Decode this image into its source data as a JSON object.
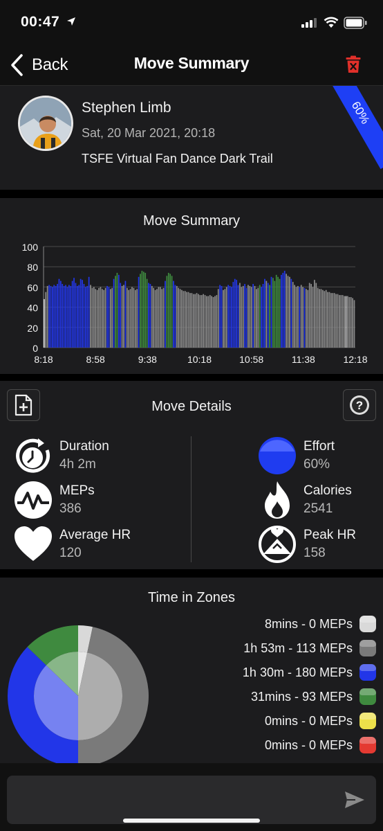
{
  "status_bar": {
    "time": "00:47"
  },
  "nav": {
    "back_label": "Back",
    "title": "Move Summary"
  },
  "profile": {
    "name": "Stephen Limb",
    "date": "Sat, 20 Mar 2021, 20:18",
    "move_name": "TSFE Virtual Fan Dance Dark Trail",
    "effort_badge": "60%"
  },
  "chart_data": {
    "type": "bar",
    "title": "Move Summary",
    "xlabel": "",
    "ylabel": "",
    "ylim": [
      0,
      100
    ],
    "yticks": [
      "100",
      "80",
      "60",
      "40",
      "20",
      "0"
    ],
    "xticks": [
      "8:18",
      "8:58",
      "9:38",
      "10:18",
      "10:58",
      "11:38",
      "12:18"
    ],
    "zone_colors": {
      "white": "#d9d9d9",
      "grey": "#8c8c8c",
      "blue": "#2236e8",
      "green": "#3f8a3f"
    },
    "values": [
      48,
      55,
      61,
      62,
      61,
      60,
      62,
      61,
      63,
      68,
      66,
      63,
      61,
      62,
      60,
      62,
      61,
      66,
      69,
      64,
      61,
      62,
      68,
      67,
      63,
      60,
      61,
      70,
      62,
      59,
      60,
      58,
      57,
      59,
      60,
      58,
      57,
      59,
      61,
      60,
      58,
      59,
      68,
      71,
      74,
      72,
      64,
      61,
      62,
      66,
      59,
      57,
      58,
      60,
      59,
      57,
      58,
      70,
      73,
      76,
      75,
      74,
      68,
      64,
      63,
      61,
      59,
      57,
      58,
      60,
      60,
      58,
      59,
      66,
      71,
      74,
      73,
      71,
      66,
      62,
      61,
      59,
      58,
      57,
      56,
      56,
      55,
      55,
      54,
      54,
      53,
      53,
      54,
      53,
      52,
      52,
      53,
      52,
      51,
      51,
      52,
      51,
      50,
      51,
      52,
      58,
      62,
      61,
      57,
      58,
      60,
      62,
      61,
      60,
      65,
      68,
      67,
      62,
      64,
      60,
      61,
      63,
      59,
      62,
      61,
      60,
      63,
      61,
      58,
      59,
      62,
      60,
      63,
      68,
      66,
      64,
      62,
      70,
      69,
      66,
      72,
      70,
      68,
      72,
      74,
      76,
      73,
      71,
      70,
      68,
      65,
      62,
      60,
      61,
      60,
      62,
      60,
      59,
      58,
      57,
      64,
      63,
      60,
      67,
      64,
      59,
      58,
      58,
      57,
      56,
      57,
      55,
      55,
      54,
      54,
      54,
      53,
      53,
      52,
      52,
      52,
      51,
      51,
      51,
      50,
      50,
      49,
      47
    ],
    "zones": [
      "white",
      "grey",
      "grey",
      "blue",
      "blue",
      "blue",
      "blue",
      "blue",
      "blue",
      "blue",
      "blue",
      "blue",
      "blue",
      "blue",
      "blue",
      "blue",
      "blue",
      "blue",
      "blue",
      "blue",
      "blue",
      "blue",
      "blue",
      "blue",
      "blue",
      "blue",
      "blue",
      "blue",
      "grey",
      "grey",
      "grey",
      "grey",
      "grey",
      "grey",
      "grey",
      "grey",
      "grey",
      "grey",
      "blue",
      "blue",
      "grey",
      "grey",
      "blue",
      "green",
      "green",
      "blue",
      "blue",
      "grey",
      "grey",
      "blue",
      "grey",
      "grey",
      "grey",
      "grey",
      "grey",
      "grey",
      "grey",
      "blue",
      "green",
      "green",
      "green",
      "green",
      "green",
      "blue",
      "blue",
      "grey",
      "grey",
      "grey",
      "grey",
      "grey",
      "grey",
      "grey",
      "grey",
      "blue",
      "green",
      "green",
      "green",
      "green",
      "blue",
      "blue",
      "grey",
      "grey",
      "grey",
      "grey",
      "grey",
      "grey",
      "grey",
      "grey",
      "grey",
      "grey",
      "grey",
      "grey",
      "grey",
      "grey",
      "grey",
      "grey",
      "grey",
      "grey",
      "grey",
      "grey",
      "grey",
      "grey",
      "grey",
      "grey",
      "grey",
      "grey",
      "blue",
      "blue",
      "grey",
      "grey",
      "grey",
      "blue",
      "blue",
      "blue",
      "blue",
      "blue",
      "blue",
      "blue",
      "grey",
      "grey",
      "grey",
      "blue",
      "blue",
      "grey",
      "grey",
      "grey",
      "blue",
      "grey",
      "grey",
      "grey",
      "green",
      "blue",
      "blue",
      "blue",
      "grey",
      "blue",
      "green",
      "blue",
      "green",
      "green",
      "green",
      "green",
      "green",
      "blue",
      "blue",
      "blue",
      "grey",
      "grey",
      "grey",
      "blue",
      "grey",
      "grey",
      "grey",
      "grey",
      "blue",
      "grey",
      "grey",
      "blue",
      "grey",
      "grey",
      "grey",
      "grey",
      "grey",
      "grey",
      "grey",
      "grey",
      "grey",
      "grey",
      "grey",
      "grey",
      "grey",
      "grey",
      "grey",
      "grey",
      "grey",
      "grey",
      "grey",
      "grey",
      "grey",
      "grey",
      "grey",
      "grey",
      "white"
    ]
  },
  "details": {
    "title": "Move Details",
    "duration": {
      "label": "Duration",
      "value": "4h 2m"
    },
    "meps": {
      "label": "MEPs",
      "value": "386"
    },
    "avg_hr": {
      "label": "Average HR",
      "value": "120"
    },
    "effort": {
      "label": "Effort",
      "value": "60%"
    },
    "calories": {
      "label": "Calories",
      "value": "2541"
    },
    "peak_hr": {
      "label": "Peak HR",
      "value": "158"
    },
    "icons": [
      "stopwatch-icon",
      "pulse-icon",
      "heart-icon",
      "effort-orb-icon",
      "flame-icon",
      "peak-hr-icon",
      "add-document-icon",
      "help-icon"
    ]
  },
  "zones": {
    "title": "Time in Zones",
    "items": [
      {
        "label": "8mins - 0 MEPs",
        "color": "#d9d9d9",
        "minutes": 8
      },
      {
        "label": "1h 53m - 113 MEPs",
        "color": "#7a7a7a",
        "minutes": 113
      },
      {
        "label": "1h 30m - 180 MEPs",
        "color": "#2236e8",
        "minutes": 90
      },
      {
        "label": "31mins - 93 MEPs",
        "color": "#3f8a3f",
        "minutes": 31
      },
      {
        "label": "0mins - 0 MEPs",
        "color": "#ece04a",
        "minutes": 0
      },
      {
        "label": "0mins - 0 MEPs",
        "color": "#e43a32",
        "minutes": 0
      }
    ]
  },
  "comment": {
    "placeholder": ""
  },
  "colors": {
    "accent_blue": "#1e3ff5",
    "delete_red": "#e0302a",
    "card_bg": "#1c1c1e"
  }
}
